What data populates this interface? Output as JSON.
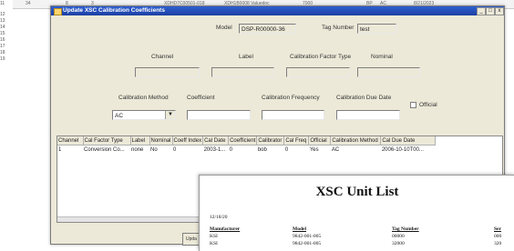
{
  "background_sheet": {
    "row_numbers": [
      "11",
      "12",
      "13",
      "14",
      "15",
      "16",
      "17",
      "18",
      "19"
    ],
    "top_cells": [
      "34",
      "8",
      "3",
      "XDHD7C00501-018",
      "XDH1B0008 Valuedoc",
      "7000",
      "BP",
      "AC",
      "8/21/2023"
    ]
  },
  "dialog": {
    "title": "Update XSC Calibration Coefficients",
    "window_buttons": {
      "minimize": "_",
      "maximize": "□",
      "close": "x"
    },
    "model_label": "Model",
    "model_value": "DSP-R00000-36",
    "tag_number_label": "Tag Number",
    "tag_number_value": "test",
    "channel_label": "Channel",
    "label_label": "Label",
    "calibration_factor_type_label": "Calibration Factor Type",
    "nominal_label": "Nominal",
    "calibration_method_label": "Calibration Method",
    "calibration_method_value": "AC",
    "coefficient_label": "Coefficient",
    "calibration_frequency_label": "Calibration Frequency",
    "calibration_due_date_label": "Calibration Due Date",
    "official_label": "Official",
    "combo_arrow": "▼"
  },
  "grid": {
    "columns": [
      "Channel",
      "Cal Factor Type",
      "Label",
      "Nominal",
      "Coeff Index",
      "Cal Date",
      "Coefficient",
      "Calibrator",
      "Cal Freq",
      "Official",
      "Calibration Method",
      "Cal Due Date"
    ],
    "rows": [
      [
        "1",
        "Conversion Co...",
        "none",
        "No",
        "0",
        "2003-1...",
        "0",
        "bob",
        "0",
        "Yes",
        "AC",
        "2006-10-10T00..."
      ]
    ]
  },
  "partial_button_label": "Upda",
  "report": {
    "title": "XSC Unit List",
    "date": "12/18/20",
    "headers": [
      "Manufacturer",
      "Model",
      "Tag Number",
      "Ser"
    ],
    "rows": [
      [
        "KSI",
        "9842-001-005",
        "00000",
        "000"
      ],
      [
        "KSI",
        "9842-001-005",
        "32000",
        "320"
      ]
    ]
  }
}
